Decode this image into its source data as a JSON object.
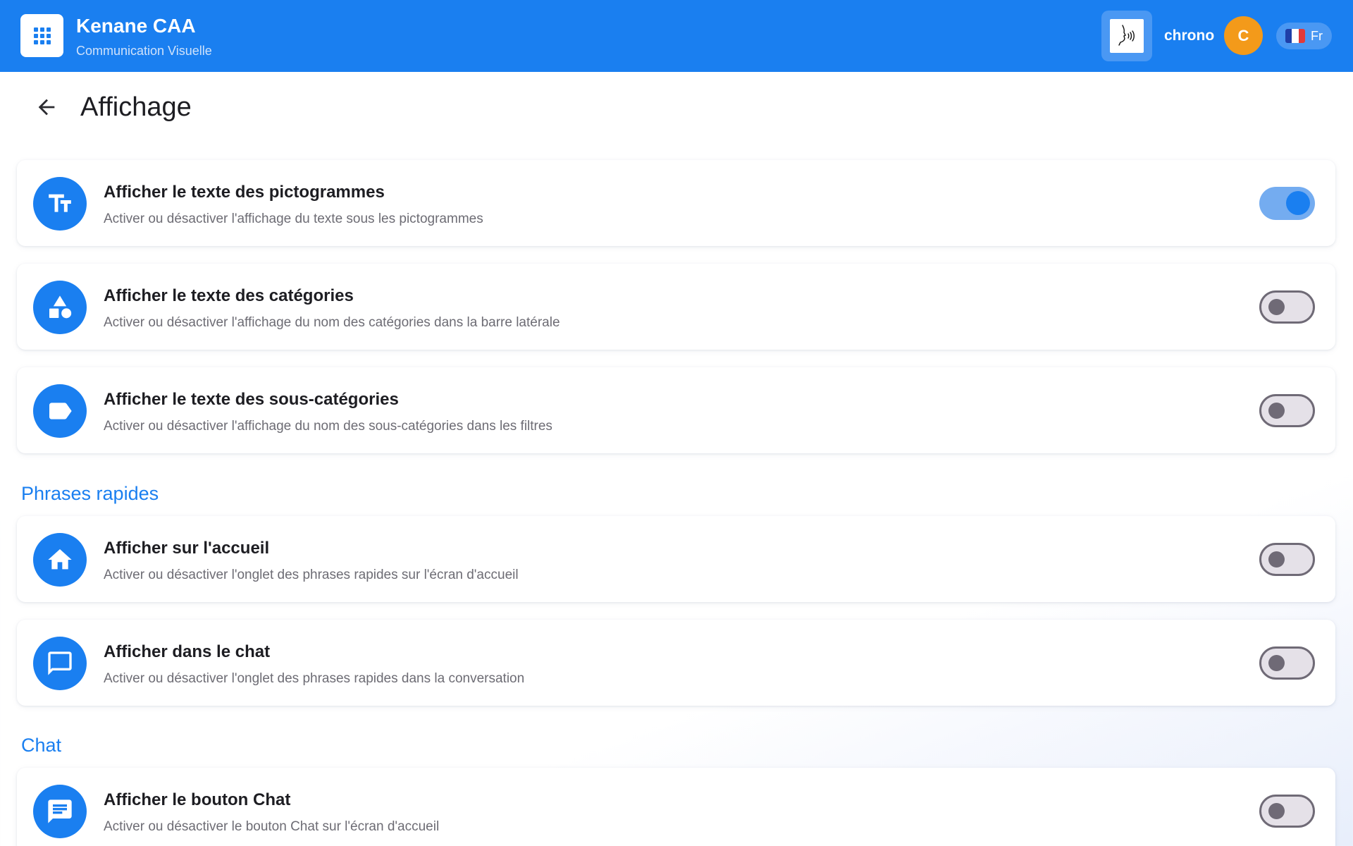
{
  "appbar": {
    "title": "Kenane CAA",
    "subtitle": "Communication Visuelle",
    "user_name": "chrono",
    "avatar_initial": "C",
    "language_label": "Fr"
  },
  "page": {
    "title": "Affichage"
  },
  "colors": {
    "primary": "#1a7ff0",
    "avatar": "#f39a1a",
    "toggle_on_track": "#74acf0",
    "toggle_off_track": "#e5e1e8"
  },
  "settings": [
    {
      "icon": "text-size-icon",
      "title": "Afficher le texte des pictogrammes",
      "description": "Activer ou désactiver l'affichage du texte sous les pictogrammes",
      "enabled": true
    },
    {
      "icon": "shapes-icon",
      "title": "Afficher le texte des catégories",
      "description": "Activer ou désactiver l'affichage du nom des catégories dans la barre latérale",
      "enabled": false
    },
    {
      "icon": "label-icon",
      "title": "Afficher le texte des sous-catégories",
      "description": "Activer ou désactiver l'affichage du nom des sous-catégories dans les filtres",
      "enabled": false
    }
  ],
  "sections": [
    {
      "title": "Phrases rapides",
      "items": [
        {
          "icon": "home-icon",
          "title": "Afficher sur l'accueil",
          "description": "Activer ou désactiver l'onglet des phrases rapides sur l'écran d'accueil",
          "enabled": false
        },
        {
          "icon": "chat-bubble-outline-icon",
          "title": "Afficher dans le chat",
          "description": "Activer ou désactiver l'onglet des phrases rapides dans la conversation",
          "enabled": false
        }
      ]
    },
    {
      "title": "Chat",
      "items": [
        {
          "icon": "chat-bubble-filled-icon",
          "title": "Afficher le bouton Chat",
          "description": "Activer ou désactiver le bouton Chat sur l'écran d'accueil",
          "enabled": false
        }
      ]
    }
  ]
}
